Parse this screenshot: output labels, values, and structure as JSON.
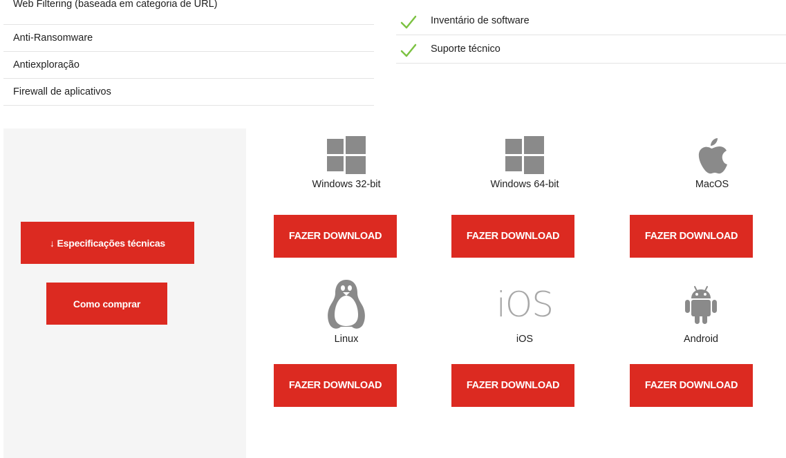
{
  "features_left": [
    "Web Filtering (baseada em categoria de URL)",
    "Anti-Ransomware",
    "Antiexploração",
    "Firewall de aplicativos"
  ],
  "features_right": [
    "Inventário de software",
    "Suporte técnico"
  ],
  "sidebar": {
    "spec_button": "↓ Especificações técnicas",
    "buy_button": "Como comprar"
  },
  "platforms": [
    {
      "name": "Windows 32-bit",
      "icon": "windows-icon",
      "button": "FAZER DOWNLOAD"
    },
    {
      "name": "Windows 64-bit",
      "icon": "windows-icon",
      "button": "FAZER DOWNLOAD"
    },
    {
      "name": "MacOS",
      "icon": "apple-icon",
      "button": "FAZER DOWNLOAD"
    },
    {
      "name": "Linux",
      "icon": "linux-penguin-icon",
      "button": "FAZER DOWNLOAD"
    },
    {
      "name": "iOS",
      "icon": "ios-icon",
      "icon_text": "iOS",
      "button": "FAZER DOWNLOAD"
    },
    {
      "name": "Android",
      "icon": "android-icon",
      "button": "FAZER DOWNLOAD"
    }
  ],
  "colors": {
    "accent": "#dc2a21",
    "check": "#7cc242",
    "icon_gray": "#8a8a8a",
    "panel_bg": "#f5f5f5"
  }
}
